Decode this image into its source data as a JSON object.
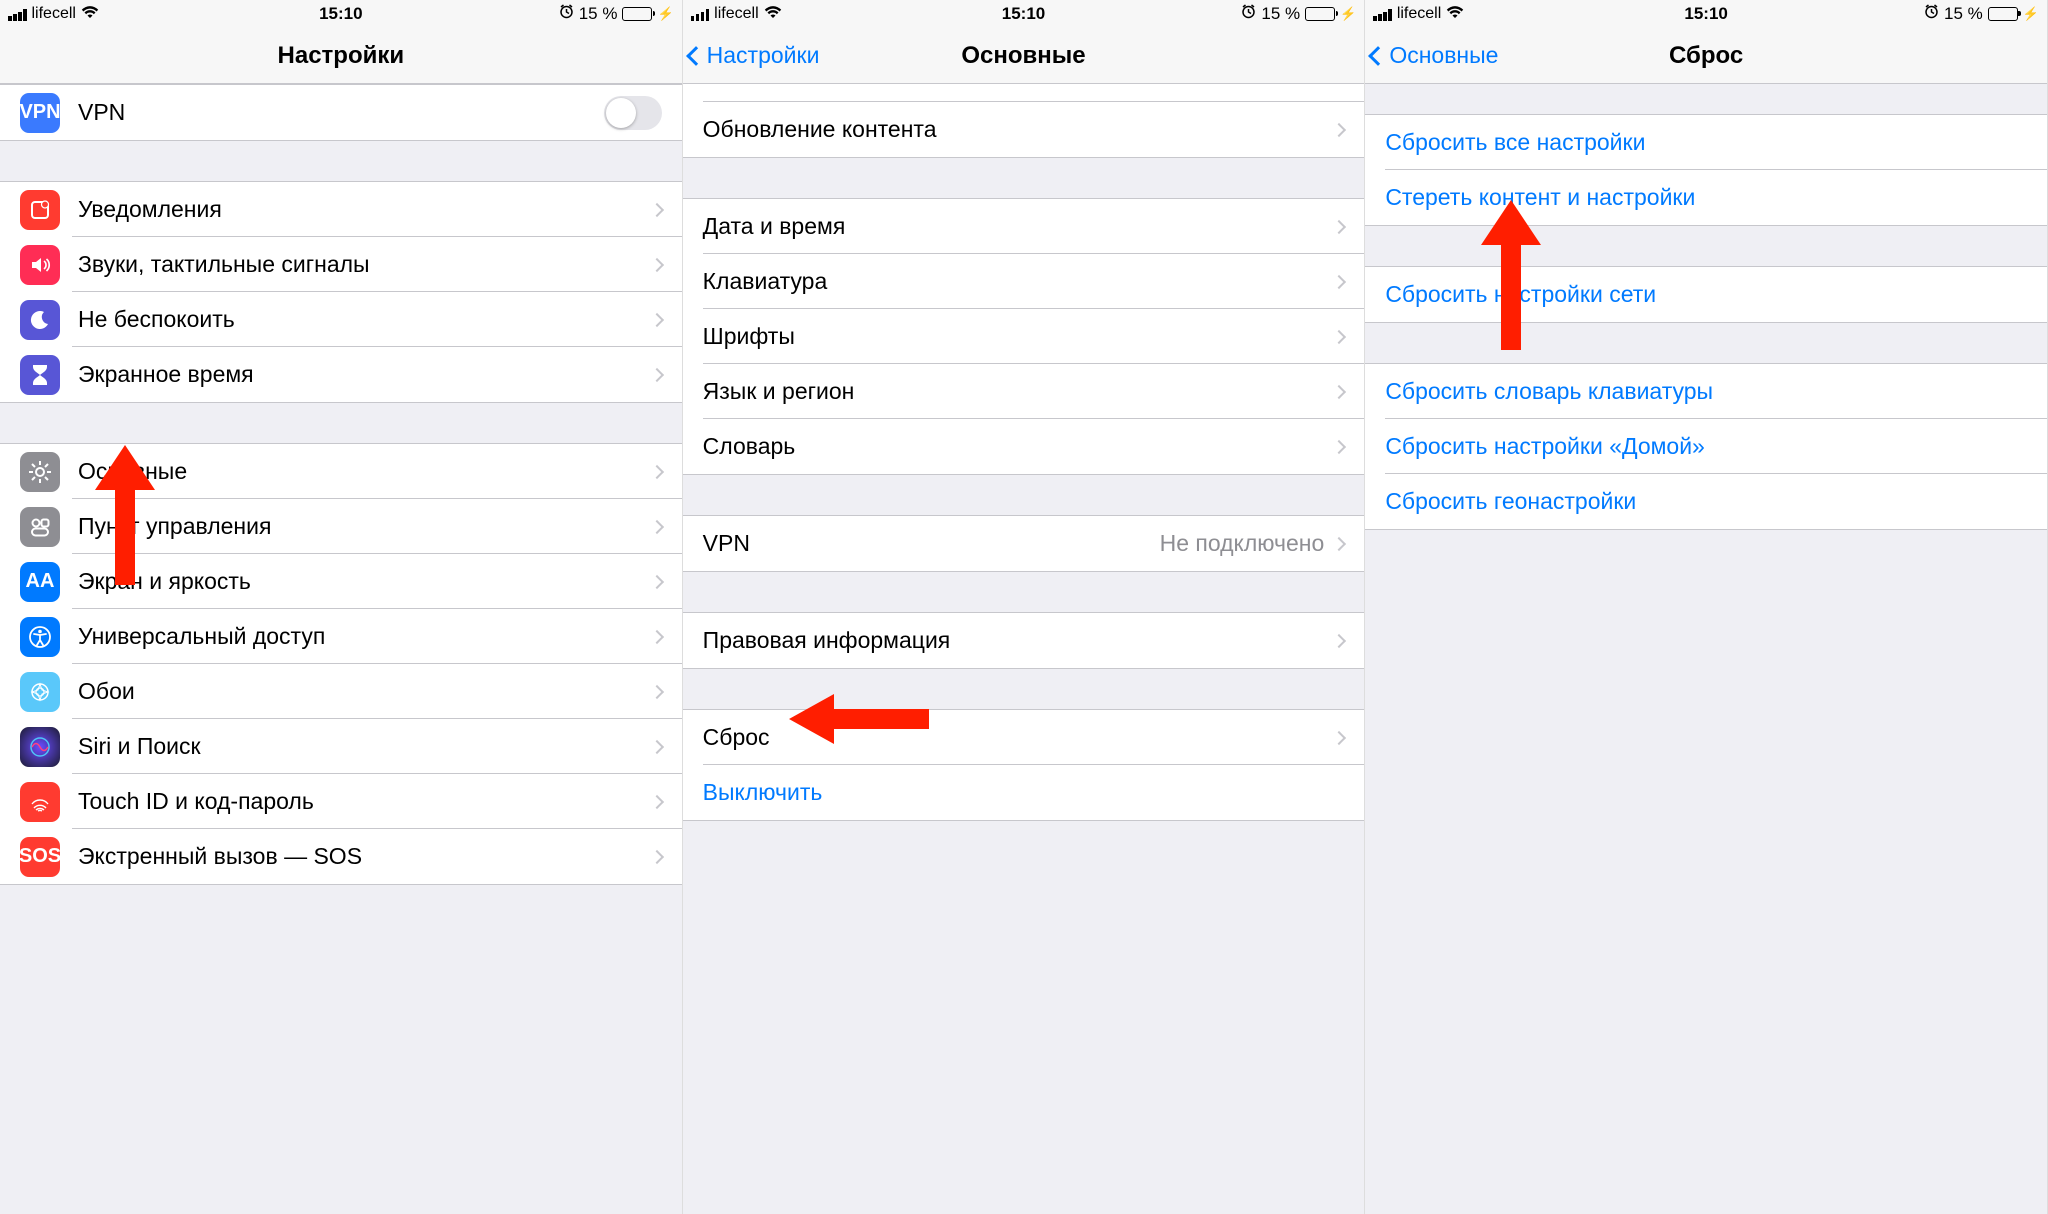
{
  "status": {
    "carrier": "lifecell",
    "time": "15:10",
    "battery_percent": "15 %"
  },
  "screen1": {
    "title": "Настройки",
    "vpn": "VPN",
    "group_notif": [
      "Уведомления",
      "Звуки, тактильные сигналы",
      "Не беспокоить",
      "Экранное время"
    ],
    "group_general": [
      "Основные",
      "Пункт управления",
      "Экран и яркость",
      "Универсальный доступ",
      "Обои",
      "Siri и Поиск",
      "Touch ID и код-пароль",
      "Экстренный вызов — SOS"
    ]
  },
  "screen2": {
    "back": "Настройки",
    "title": "Основные",
    "items_top": [
      "Обновление контента"
    ],
    "items_datetime": [
      "Дата и время",
      "Клавиатура",
      "Шрифты",
      "Язык и регион",
      "Словарь"
    ],
    "vpn_label": "VPN",
    "vpn_detail": "Не подключено",
    "legal": "Правовая информация",
    "reset": "Сброс",
    "shutdown": "Выключить"
  },
  "screen3": {
    "back": "Основные",
    "title": "Сброс",
    "group1": [
      "Сбросить все настройки",
      "Стереть контент и настройки"
    ],
    "group2": [
      "Сбросить настройки сети"
    ],
    "group3": [
      "Сбросить словарь клавиатуры",
      "Сбросить настройки «Домой»",
      "Сбросить геонастройки"
    ]
  }
}
